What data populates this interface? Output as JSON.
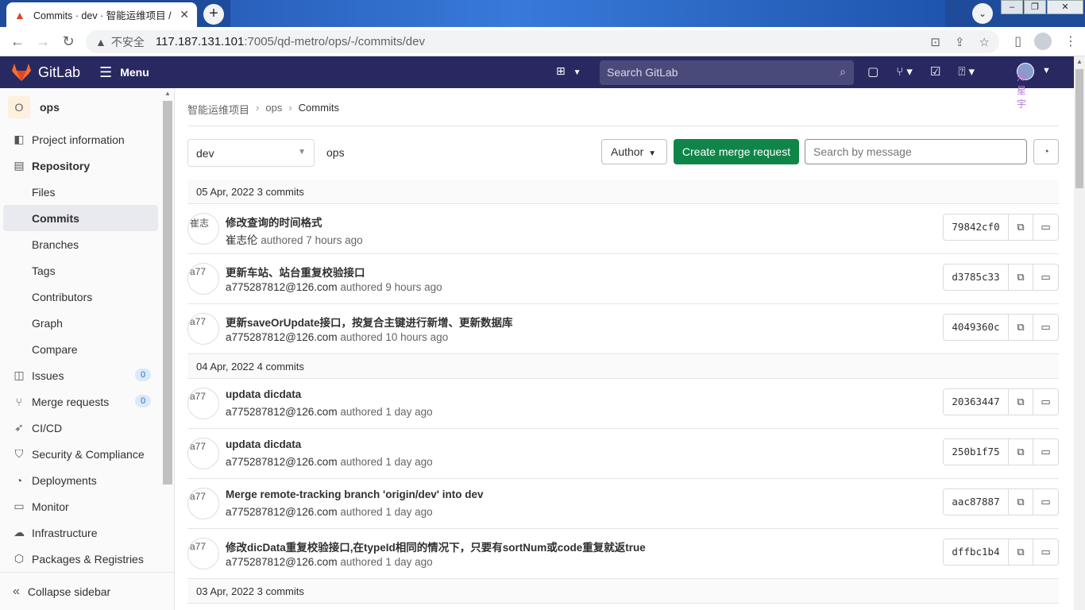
{
  "browser": {
    "tab_title": "Commits · dev · 智能运维项目 /",
    "tab_close": "✕",
    "new_tab": "+",
    "insecure_label": "不安全",
    "url_host": "117.187.131.101",
    "url_path": ":7005/qd-metro/ops/-/commits/dev"
  },
  "header": {
    "brand": "GitLab",
    "menu_label": "Menu",
    "search_placeholder": "Search GitLab",
    "user_avatar_alt": "郑星宇"
  },
  "sidebar": {
    "project_initial": "O",
    "project_name": "ops",
    "items": [
      {
        "label": "Project information",
        "icon": "info-icon"
      },
      {
        "label": "Repository",
        "icon": "book-icon"
      },
      {
        "label": "Files"
      },
      {
        "label": "Commits"
      },
      {
        "label": "Branches"
      },
      {
        "label": "Tags"
      },
      {
        "label": "Contributors"
      },
      {
        "label": "Graph"
      },
      {
        "label": "Compare"
      },
      {
        "label": "Issues",
        "icon": "issues-icon",
        "count": "0"
      },
      {
        "label": "Merge requests",
        "icon": "merge-request-icon",
        "count": "0"
      },
      {
        "label": "CI/CD",
        "icon": "rocket-icon"
      },
      {
        "label": "Security & Compliance",
        "icon": "shield-icon"
      },
      {
        "label": "Deployments",
        "icon": "deployments-icon"
      },
      {
        "label": "Monitor",
        "icon": "monitor-icon"
      },
      {
        "label": "Infrastructure",
        "icon": "cloud-icon"
      },
      {
        "label": "Packages & Registries",
        "icon": "package-icon"
      }
    ],
    "collapse_label": "Collapse sidebar"
  },
  "main": {
    "breadcrumb": [
      "智能运维项目",
      "ops",
      "Commits"
    ],
    "branch": "dev",
    "path": "ops",
    "author_label": "Author",
    "create_mr_label": "Create merge request",
    "search_placeholder": "Search by message",
    "days": [
      {
        "date": "05 Apr, 2022",
        "count": "3 commits",
        "commits": [
          {
            "title": "修改查询的时间格式",
            "author": "崔志伦",
            "authored": "authored 7 hours ago",
            "sha": "79842cf0",
            "avatar_alt": "崔志"
          },
          {
            "title": "更新车站、站台重复校验接口",
            "author": "a775287812@126.com",
            "authored": "authored 9 hours ago",
            "sha": "d3785c33",
            "avatar_alt": "a77"
          },
          {
            "title": "更新saveOrUpdate接口，按复合主键进行新增、更新数据库",
            "author": "a775287812@126.com",
            "authored": "authored 10 hours ago",
            "sha": "4049360c",
            "avatar_alt": "a77"
          }
        ]
      },
      {
        "date": "04 Apr, 2022",
        "count": "4 commits",
        "commits": [
          {
            "title": "updata dicdata",
            "author": "a775287812@126.com",
            "authored": "authored 1 day ago",
            "sha": "20363447",
            "avatar_alt": "a77"
          },
          {
            "title": "updata dicdata",
            "author": "a775287812@126.com",
            "authored": "authored 1 day ago",
            "sha": "250b1f75",
            "avatar_alt": "a77"
          },
          {
            "title": "Merge remote-tracking branch 'origin/dev' into dev",
            "author": "a775287812@126.com",
            "authored": "authored 1 day ago",
            "sha": "aac87887",
            "avatar_alt": "a77"
          },
          {
            "title": "修改dicData重复校验接口,在typeId相同的情况下，只要有sortNum或code重复就返true",
            "author": "a775287812@126.com",
            "authored": "authored 1 day ago",
            "sha": "dffbc1b4",
            "avatar_alt": "a77"
          }
        ]
      },
      {
        "date": "03 Apr, 2022",
        "count": "3 commits",
        "commits": []
      }
    ]
  }
}
